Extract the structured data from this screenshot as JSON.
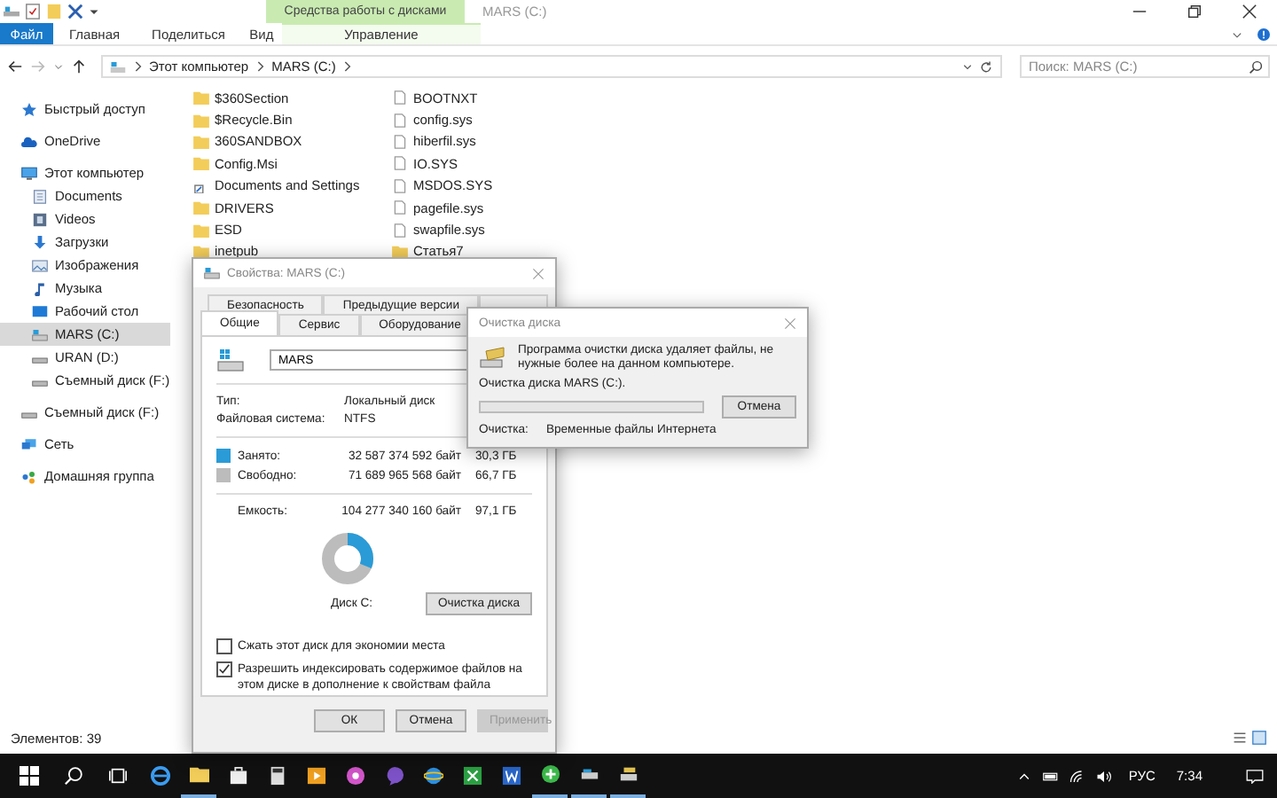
{
  "window": {
    "title": "MARS (C:)",
    "context_group": "Средства работы с дисками",
    "ribbon_tabs": [
      {
        "label": "Файл",
        "kind": "file",
        "selected": true
      },
      {
        "label": "Главная",
        "kind": "tab",
        "selected": false
      },
      {
        "label": "Поделиться",
        "kind": "tab",
        "selected": false
      },
      {
        "label": "Вид",
        "kind": "tab",
        "selected": false
      },
      {
        "label": "Управление",
        "kind": "context",
        "selected": false
      }
    ],
    "breadcrumb": [
      "Этот компьютер",
      "MARS (C:)"
    ],
    "search": {
      "placeholder": "Поиск: MARS (C:)"
    }
  },
  "sidebar": {
    "items": [
      {
        "label": "Быстрый доступ",
        "kind": "star",
        "selected": false
      },
      {
        "label": "OneDrive",
        "kind": "cloud",
        "selected": false
      },
      {
        "label": "Этот компьютер",
        "kind": "computer",
        "selected": false,
        "children": [
          {
            "label": "Documents",
            "kind": "document",
            "selected": false
          },
          {
            "label": "Videos",
            "kind": "video",
            "selected": false
          },
          {
            "label": "Загрузки",
            "kind": "download",
            "selected": false
          },
          {
            "label": "Изображения",
            "kind": "picture",
            "selected": false
          },
          {
            "label": "Музыка",
            "kind": "music",
            "selected": false
          },
          {
            "label": "Рабочий стол",
            "kind": "desktop",
            "selected": false
          },
          {
            "label": "MARS (C:)",
            "kind": "drive",
            "selected": true
          },
          {
            "label": "URAN (D:)",
            "kind": "removable",
            "selected": false
          },
          {
            "label": "Съемный диск (F:)",
            "kind": "removable",
            "selected": false
          }
        ]
      },
      {
        "label": "Съемный диск (F:)",
        "kind": "removable",
        "selected": false
      },
      {
        "label": "Сеть",
        "kind": "network",
        "selected": false
      },
      {
        "label": "Домашняя группа",
        "kind": "homegroup",
        "selected": false
      }
    ]
  },
  "files": [
    {
      "name": "$360Section",
      "kind": "folder"
    },
    {
      "name": "$Recycle.Bin",
      "kind": "folder"
    },
    {
      "name": "360SANDBOX",
      "kind": "folder"
    },
    {
      "name": "Config.Msi",
      "kind": "folder"
    },
    {
      "name": "Documents and Settings",
      "kind": "shortcut"
    },
    {
      "name": "DRIVERS",
      "kind": "folder"
    },
    {
      "name": "ESD",
      "kind": "folder"
    },
    {
      "name": "inetpub",
      "kind": "folder"
    },
    {
      "name": "BOOTNXT",
      "kind": "file"
    },
    {
      "name": "config.sys",
      "kind": "file"
    },
    {
      "name": "hiberfil.sys",
      "kind": "file"
    },
    {
      "name": "IO.SYS",
      "kind": "file"
    },
    {
      "name": "MSDOS.SYS",
      "kind": "file"
    },
    {
      "name": "pagefile.sys",
      "kind": "file"
    },
    {
      "name": "swapfile.sys",
      "kind": "file"
    },
    {
      "name": "Статья7",
      "kind": "folder"
    }
  ],
  "status_bar": {
    "count": "Элементов: 39"
  },
  "properties": {
    "title": "Свойства: MARS (C:)",
    "tab_rows": [
      [
        {
          "label": "Безопасность",
          "selected": false
        },
        {
          "label": "Предыдущие версии",
          "selected": false
        },
        {
          "selected": false
        }
      ],
      [
        {
          "label": "Общие",
          "selected": true
        },
        {
          "label": "Сервис",
          "selected": false
        },
        {
          "label": "Оборудование",
          "selected": false
        }
      ]
    ],
    "name_value": "MARS",
    "info": [
      {
        "label": "Тип:",
        "value": "Локальный диск"
      },
      {
        "label": "Файловая система:",
        "value": "NTFS"
      }
    ],
    "space": [
      {
        "label": "Занято:",
        "bytes": "32 587 374 592 байт",
        "size": "30,3 ГБ",
        "color": "#2a9bd7"
      },
      {
        "label": "Свободно:",
        "bytes": "71 689 965 568 байт",
        "size": "66,7 ГБ",
        "color": "#bcbcbc"
      }
    ],
    "capacity": {
      "label": "Емкость:",
      "bytes": "104 277 340 160 байт",
      "size": "97,1 ГБ"
    },
    "usage": {
      "level": 0.31
    },
    "disk_label": "Диск C:",
    "cleanup_button": "Очистка диска",
    "checkboxes": [
      {
        "label": "Сжать этот диск для экономии места",
        "checked": false
      },
      {
        "label": "Разрешить индексировать содержимое файлов на этом диске в дополнение к свойствам файла",
        "checked": true
      }
    ],
    "buttons": [
      {
        "label": "ОК",
        "disabled": false
      },
      {
        "label": "Отмена",
        "disabled": false
      },
      {
        "label": "Применить",
        "disabled": true
      }
    ]
  },
  "cleanup": {
    "title": "Очистка диска",
    "message": "Программа очистки диска удаляет файлы, не нужные более на данном компьютере.",
    "progress_label": "Очистка диска MARS (C:).",
    "progress": {
      "level": 0
    },
    "cancel": "Отмена",
    "status_label": "Очистка:",
    "status_value": "Временные файлы Интернета"
  },
  "taskbar": {
    "apps": [
      {
        "kind": "browser",
        "running": false
      },
      {
        "kind": "folder",
        "running": true
      },
      {
        "kind": "store",
        "running": false
      },
      {
        "kind": "calculator",
        "running": false
      },
      {
        "kind": "media",
        "running": false
      },
      {
        "kind": "ball",
        "running": false
      },
      {
        "kind": "chat",
        "running": false
      },
      {
        "kind": "globe",
        "running": false
      },
      {
        "kind": "sheet",
        "running": false
      },
      {
        "kind": "doc",
        "running": false
      },
      {
        "kind": "plus",
        "running": true
      },
      {
        "kind": "drive",
        "running": true
      },
      {
        "kind": "disk",
        "running": true
      }
    ],
    "language": "РУС",
    "time": "7:34"
  }
}
